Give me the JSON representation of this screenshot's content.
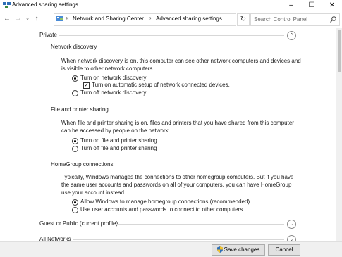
{
  "window": {
    "title": "Advanced sharing settings",
    "minimize": "–",
    "maximize": "☐",
    "close": "✕"
  },
  "nav": {
    "back": "←",
    "forward": "→",
    "recent": "⌄",
    "up": "↑"
  },
  "address": {
    "overflow": "«",
    "crumbs": [
      "Network and Sharing Center",
      "Advanced sharing settings"
    ],
    "sep": "›",
    "dropdown": "⌄",
    "refresh": "↻"
  },
  "search": {
    "placeholder": "Search Control Panel"
  },
  "sections": {
    "private": {
      "label": "Private",
      "chevron": "⌃"
    },
    "network_discovery": {
      "label": "Network discovery",
      "description": "When network discovery is on, this computer can see other network computers and devices and is visible to other network computers.",
      "on": "Turn on network discovery",
      "auto_setup": "Turn on automatic setup of network connected devices.",
      "off": "Turn off network discovery"
    },
    "file_printer": {
      "label": "File and printer sharing",
      "description": "When file and printer sharing is on, files and printers that you have shared from this computer can be accessed by people on the network.",
      "on": "Turn on file and printer sharing",
      "off": "Turn off file and printer sharing"
    },
    "homegroup": {
      "label": "HomeGroup connections",
      "description": "Typically, Windows manages the connections to other homegroup computers. But if you have the same user accounts and passwords on all of your computers, you can have HomeGroup use your account instead.",
      "allow": "Allow Windows to manage homegroup connections (recommended)",
      "use_accounts": "Use user accounts and passwords to connect to other computers"
    },
    "guest": {
      "label": "Guest or Public (current profile)",
      "chevron": "⌄"
    },
    "all": {
      "label": "All Networks",
      "chevron": "⌄"
    }
  },
  "state": {
    "network_discovery": "on",
    "auto_setup_checked": true,
    "file_printer": "on",
    "homegroup": "allow"
  },
  "footer": {
    "save": "Save changes",
    "cancel": "Cancel"
  }
}
